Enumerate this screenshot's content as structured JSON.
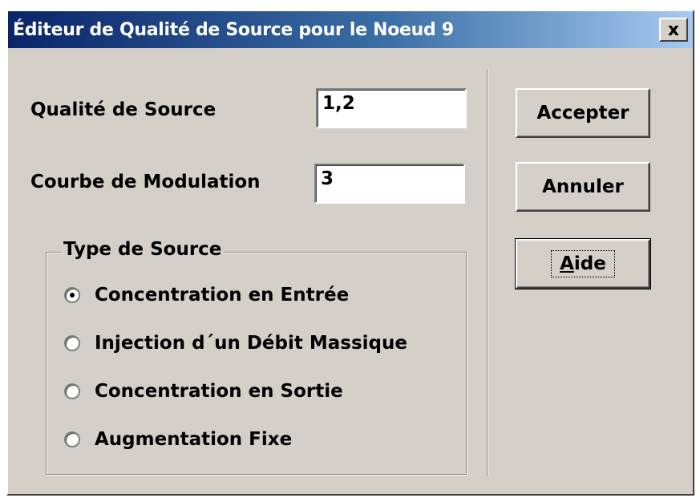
{
  "window": {
    "title": "Éditeur de Qualité de Source pour le Noeud  9",
    "close_symbol": "x"
  },
  "form": {
    "quality_label": "Qualité de Source",
    "quality_value": "1,2",
    "modulation_label": "Courbe de  Modulation",
    "modulation_value": "3"
  },
  "source_type": {
    "title": "Type de Source",
    "options": [
      {
        "label": "Concentration en Entrée",
        "checked": true
      },
      {
        "label": "Injection d´un Débit Massique",
        "checked": false
      },
      {
        "label": "Concentration en Sortie",
        "checked": false
      },
      {
        "label": "Augmentation Fixe",
        "checked": false
      }
    ]
  },
  "buttons": {
    "accept": "Accepter",
    "cancel": "Annuler",
    "help_mnemonic": "A",
    "help_rest": "ide"
  },
  "colors": {
    "dialog_face": "#d4d0c8",
    "titlebar_start": "#0a246a",
    "titlebar_end": "#a6caf0"
  }
}
